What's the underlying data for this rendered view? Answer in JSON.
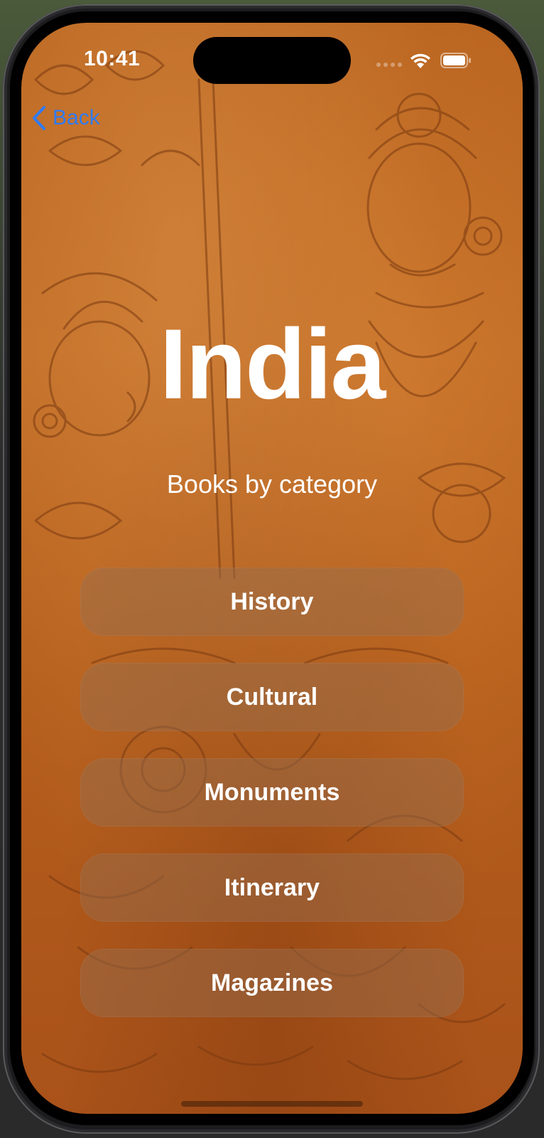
{
  "status_bar": {
    "time": "10:41"
  },
  "navigation": {
    "back_label": "Back"
  },
  "header": {
    "title": "India",
    "subtitle": "Books by category"
  },
  "categories": [
    {
      "label": "History"
    },
    {
      "label": "Cultural"
    },
    {
      "label": "Monuments"
    },
    {
      "label": "Itinerary"
    },
    {
      "label": "Magazines"
    }
  ],
  "colors": {
    "accent": "#2f7bf6",
    "background": "#b8631f",
    "button_fill": "rgba(150,110,80,0.45)",
    "text": "#ffffff"
  },
  "icons": {
    "back": "chevron-left-icon",
    "wifi": "wifi-icon",
    "battery": "battery-icon"
  }
}
